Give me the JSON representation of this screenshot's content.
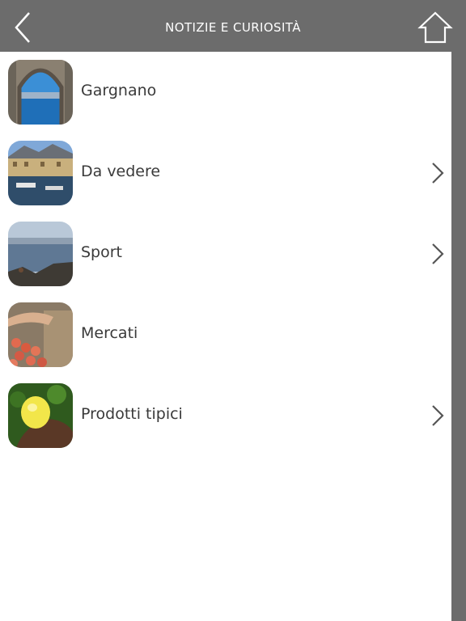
{
  "nav": {
    "title": "NOTIZIE E CURIOSITÀ",
    "back_icon": "chevron-left-icon",
    "home_icon": "home-icon"
  },
  "items": [
    {
      "label": "Gargnano",
      "has_chevron": false
    },
    {
      "label": "Da vedere",
      "has_chevron": true
    },
    {
      "label": "Sport",
      "has_chevron": true
    },
    {
      "label": "Mercati",
      "has_chevron": false
    },
    {
      "label": "Prodotti tipici",
      "has_chevron": true
    }
  ],
  "colors": {
    "nav_bg": "#6c6c6c",
    "content_bg": "#ffffff",
    "text": "#3a3a3a",
    "chevron": "#555555"
  }
}
